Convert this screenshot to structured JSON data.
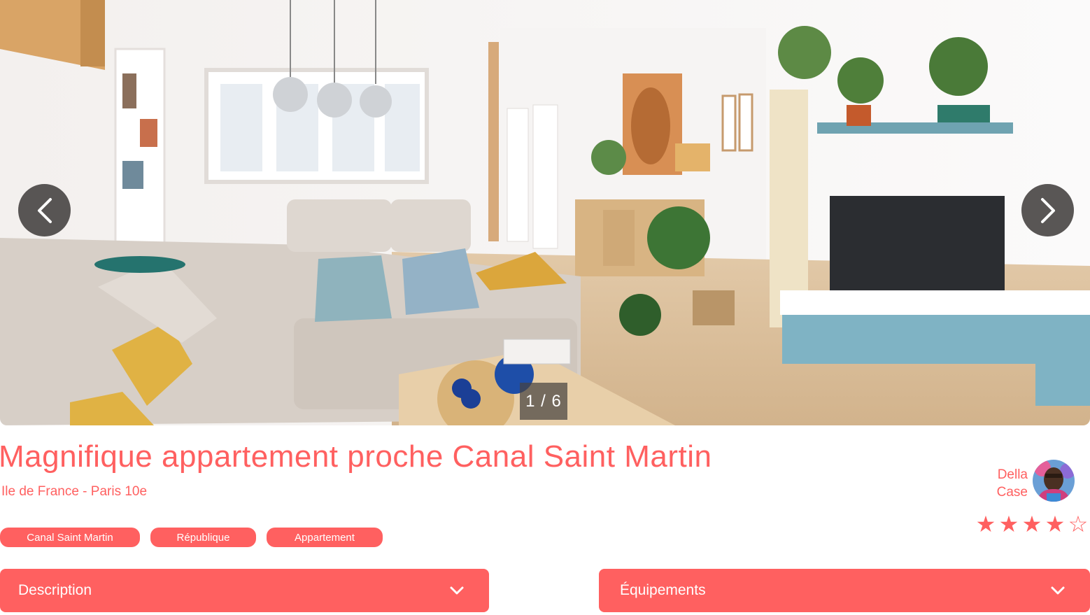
{
  "carousel": {
    "counter": "1 / 6",
    "current": 1,
    "total": 6
  },
  "listing": {
    "title": "Magnifique appartement proche Canal Saint Martin",
    "location": "Ile de France - Paris 10e",
    "tags": [
      "Canal Saint Martin",
      "République",
      "Appartement"
    ]
  },
  "host": {
    "first_name": "Della",
    "last_name": "Case"
  },
  "rating": {
    "value": 4,
    "max": 5
  },
  "sections": {
    "description_label": "Description",
    "equipments_label": "Équipements"
  },
  "icons": {
    "prev": "chevron-left-icon",
    "next": "chevron-right-icon",
    "collapse": "chevron-down-icon",
    "star_filled": "star-filled-icon",
    "star_empty": "star-empty-icon"
  },
  "colors": {
    "accent": "#ff6060",
    "on_accent": "#ffffff",
    "overlay": "#4b4846"
  }
}
